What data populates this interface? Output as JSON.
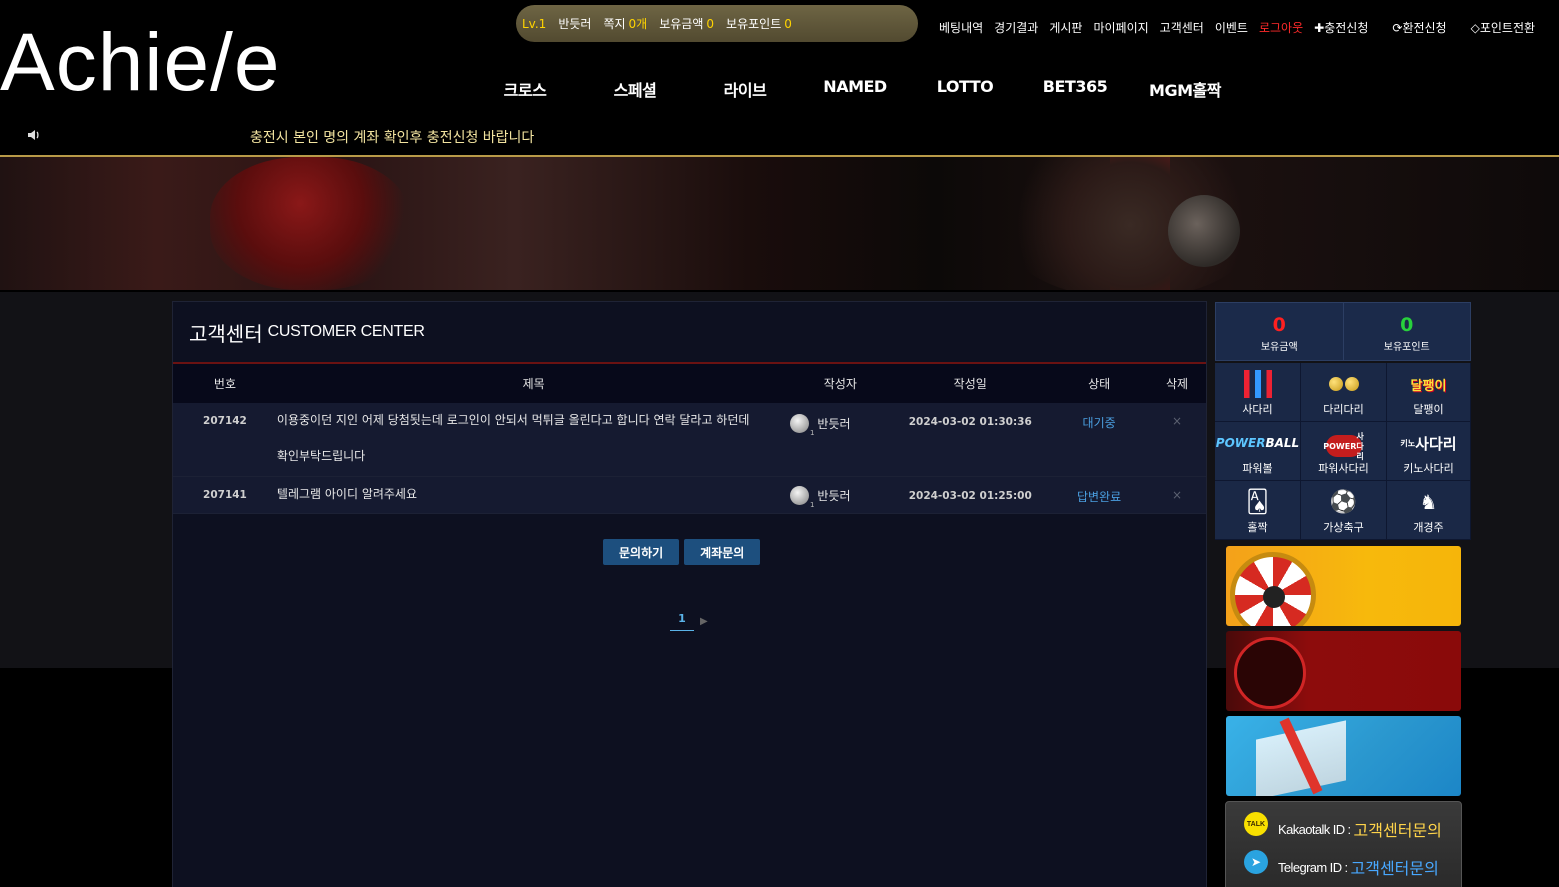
{
  "logo": {
    "text": "Achie/e"
  },
  "userbar": {
    "level": "Lv.1",
    "username": "반듯러",
    "memo_label": "쪽지",
    "memo_count": "0개",
    "money_label": "보유금액",
    "money_value": "0",
    "point_label": "보유포인트",
    "point_value": "0"
  },
  "top_menu": {
    "betting_history": "베팅내역",
    "match_results": "경기결과",
    "board": "게시판",
    "mypage": "마이페이지",
    "customer_center": "고객센터",
    "event": "이벤트",
    "logout": "로그아웃",
    "deposit": "충전신청",
    "withdraw": "환전신청",
    "point_exchange": "포인트전환"
  },
  "main_nav": [
    "크로스",
    "스페셜",
    "라이브",
    "NAMED",
    "LOTTO",
    "BET365",
    "MGM홀짝"
  ],
  "notice": "충전시 본인 명의 계좌 확인후 충전신청 바랍니다",
  "panel": {
    "title_kr": "고객센터",
    "title_en": "CUSTOMER CENTER",
    "columns": [
      "번호",
      "제목",
      "작성자",
      "작성일",
      "상태",
      "삭제"
    ],
    "rows": [
      {
        "no": "207142",
        "title_line1": "이용중이던 지인 어제 당첨됫는데 로그인이 안되서 먹튀글 올린다고 합니다 연락 달라고 하던데",
        "title_line2": "확인부탁드립니다",
        "author": "반듯러",
        "level": "1",
        "date": "2024-03-02 01:30:36",
        "status": "대기중",
        "delete": "×"
      },
      {
        "no": "207141",
        "title_line1": "텔레그램 아이디 알려주세요",
        "title_line2": "",
        "author": "반듯러",
        "level": "1",
        "date": "2024-03-02 01:25:00",
        "status": "답변완료",
        "delete": "×"
      }
    ],
    "buttons": {
      "inquiry": "문의하기",
      "account_inquiry": "계좌문의"
    },
    "pagination": {
      "current": "1",
      "next": "▶"
    }
  },
  "sidebar": {
    "money_value": "0",
    "money_label": "보유금액",
    "point_value": "0",
    "point_label": "보유포인트",
    "games": [
      {
        "label": "사다리",
        "icon": "ladder-icon"
      },
      {
        "label": "다리다리",
        "icon": "balls-icon"
      },
      {
        "label": "달팽이",
        "icon": "snail-icon"
      },
      {
        "label": "파워볼",
        "icon": "powerball-icon"
      },
      {
        "label": "파워사다리",
        "icon": "power-ladder-icon"
      },
      {
        "label": "키노사다리",
        "icon": "keno-ladder-icon"
      },
      {
        "label": "홀짝",
        "icon": "cards-icon"
      },
      {
        "label": "가상축구",
        "icon": "soccer-icon"
      },
      {
        "label": "개경주",
        "icon": "horse-icon"
      }
    ],
    "game_icon_text": {
      "snail": "달팽이",
      "powerball_top": "POWER",
      "powerball_bottom": "BALL",
      "power_ladder_top": "POWER",
      "power_ladder_bottom": "사다리",
      "keno_prefix": "키노",
      "keno_main": "사다리"
    },
    "contact": {
      "kakao_label": "Kakaotalk ID :",
      "kakao_value": "고객센터문의",
      "telegram_label": "Telegram ID :",
      "telegram_value": "고객센터문의",
      "kakao_badge": "TALK"
    }
  },
  "colors": {
    "gold_line": "#b89a48",
    "status_blue": "#4a9fe0",
    "logout_red": "#ff2a2a",
    "money_red": "#ff2020",
    "point_green": "#28d03c",
    "button_blue": "#1d4f7e"
  }
}
